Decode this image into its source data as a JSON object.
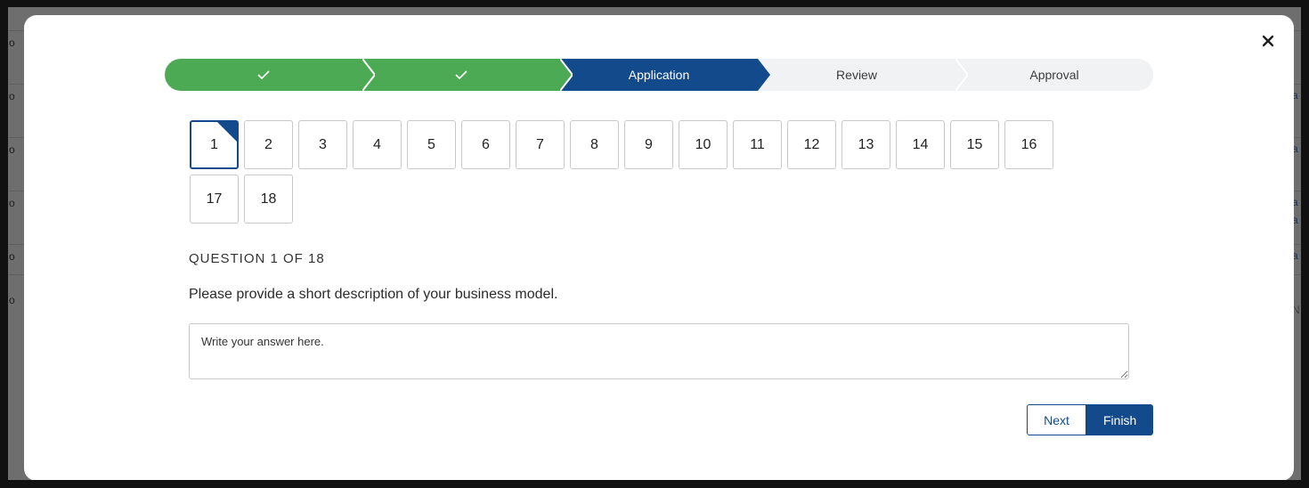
{
  "background": {
    "left_glyphs": [
      "o",
      "o",
      "o",
      "o",
      "o",
      "o"
    ],
    "right_glyphs": [
      "a",
      "a",
      "a",
      "a",
      "a",
      "N"
    ]
  },
  "stepper": {
    "steps": [
      {
        "label": "",
        "state": "done",
        "icon": "check-icon"
      },
      {
        "label": "",
        "state": "done",
        "icon": "check-icon"
      },
      {
        "label": "Application",
        "state": "active"
      },
      {
        "label": "Review",
        "state": "pending"
      },
      {
        "label": "Approval",
        "state": "pending"
      }
    ]
  },
  "questions": {
    "numbers": [
      "1",
      "2",
      "3",
      "4",
      "5",
      "6",
      "7",
      "8",
      "9",
      "10",
      "11",
      "12",
      "13",
      "14",
      "15",
      "16",
      "17",
      "18"
    ],
    "current": "1"
  },
  "question": {
    "counter": "QUESTION 1 OF 18",
    "text": "Please provide a short description of your business model.",
    "placeholder": "Write your answer here.",
    "value": ""
  },
  "buttons": {
    "next_label": "Next",
    "finish_label": "Finish"
  },
  "colors": {
    "done": "#4caa55",
    "active": "#134a8c",
    "pending": "#f1f2f4"
  }
}
